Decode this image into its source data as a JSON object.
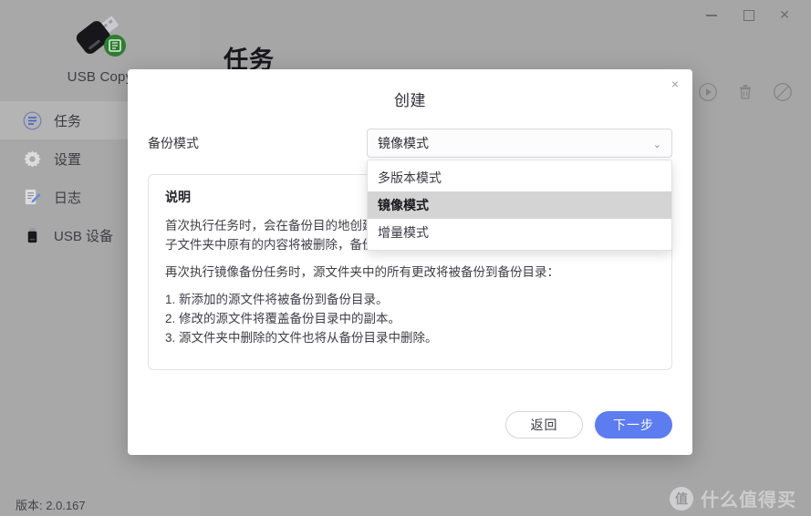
{
  "window": {
    "minimize_label": "Minimize",
    "maximize_label": "Maximize",
    "close_label": "Close"
  },
  "sidebar": {
    "app_name": "USB Copy",
    "items": [
      {
        "label": "任务",
        "icon": "tasks-icon",
        "active": true
      },
      {
        "label": "设置",
        "icon": "gear-icon",
        "active": false
      },
      {
        "label": "日志",
        "icon": "log-edit-icon",
        "active": false
      },
      {
        "label": "USB 设备",
        "icon": "usb-device-icon",
        "active": false
      }
    ]
  },
  "main": {
    "page_title": "任务",
    "toolbar": [
      {
        "name": "run-icon",
        "label": "运行"
      },
      {
        "name": "delete-icon",
        "label": "删除"
      },
      {
        "name": "disable-icon",
        "label": "禁用"
      }
    ],
    "version": "版本: 2.0.167",
    "watermark": {
      "badge": "值",
      "text": "什么值得买"
    }
  },
  "modal": {
    "title": "创建",
    "close_label": "×",
    "field": {
      "label": "备份模式",
      "selected_value": "镜像模式",
      "caret": "⌃",
      "options": [
        {
          "label": "多版本模式",
          "selected": false
        },
        {
          "label": "镜像模式",
          "selected": true
        },
        {
          "label": "增量模式",
          "selected": false
        }
      ]
    },
    "description": {
      "heading": "说明",
      "paragraphs": [
        "首次执行任务时，会在备份目的地创建一个子目录。如果已经存在同名的子文件夹，则该子文件夹中原有的内容将被删除，备份完成后该子文件夹和备份源保持一致。",
        "再次执行镜像备份任务时，源文件夹中的所有更改将被备份到备份目录："
      ],
      "list": [
        "1. 新添加的源文件将被备份到备份目录。",
        "2. 修改的源文件将覆盖备份目录中的副本。",
        "3. 源文件夹中删除的文件也将从备份目录中删除。"
      ]
    },
    "buttons": {
      "back": "返回",
      "next": "下一步"
    }
  },
  "colors": {
    "primary": "#5c7cf0",
    "app_background": "#a6a6a6",
    "sidebar_active": "#b4b4b4",
    "option_selected": "#d4d4d4",
    "modal_background": "#ffffff"
  }
}
